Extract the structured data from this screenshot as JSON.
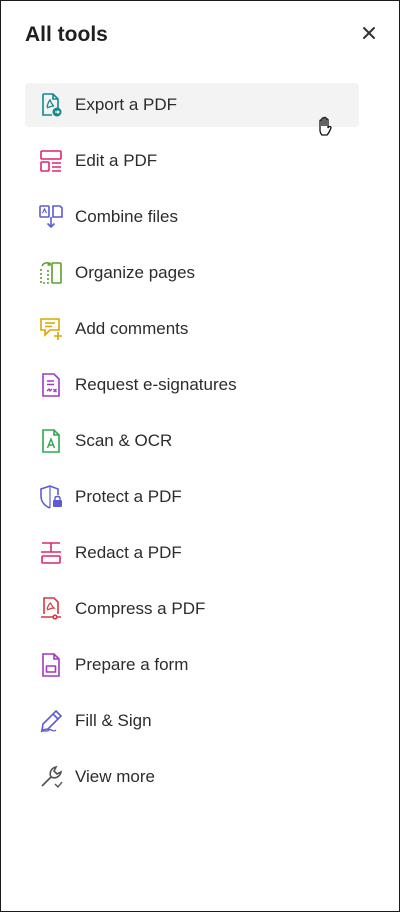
{
  "header": {
    "title": "All tools"
  },
  "tools": [
    {
      "label": "Export a PDF",
      "icon": "export-pdf-icon",
      "color": "#14898c"
    },
    {
      "label": "Edit a PDF",
      "icon": "edit-pdf-icon",
      "color": "#e0256f"
    },
    {
      "label": "Combine files",
      "icon": "combine-files-icon",
      "color": "#5b5bd6"
    },
    {
      "label": "Organize pages",
      "icon": "organize-pages-icon",
      "color": "#5aa02c"
    },
    {
      "label": "Add comments",
      "icon": "add-comments-icon",
      "color": "#d6a800"
    },
    {
      "label": "Request e-signatures",
      "icon": "request-esignatures-icon",
      "color": "#a038c4"
    },
    {
      "label": "Scan & OCR",
      "icon": "scan-ocr-icon",
      "color": "#2fa84f"
    },
    {
      "label": "Protect a PDF",
      "icon": "protect-pdf-icon",
      "color": "#5b5bd6"
    },
    {
      "label": "Redact a PDF",
      "icon": "redact-pdf-icon",
      "color": "#e0256f"
    },
    {
      "label": "Compress a PDF",
      "icon": "compress-pdf-icon",
      "color": "#d7373f"
    },
    {
      "label": "Prepare a form",
      "icon": "prepare-form-icon",
      "color": "#a038c4"
    },
    {
      "label": "Fill & Sign",
      "icon": "fill-sign-icon",
      "color": "#5b5bd6"
    },
    {
      "label": "View more",
      "icon": "wrench-icon",
      "color": "#505050"
    }
  ]
}
